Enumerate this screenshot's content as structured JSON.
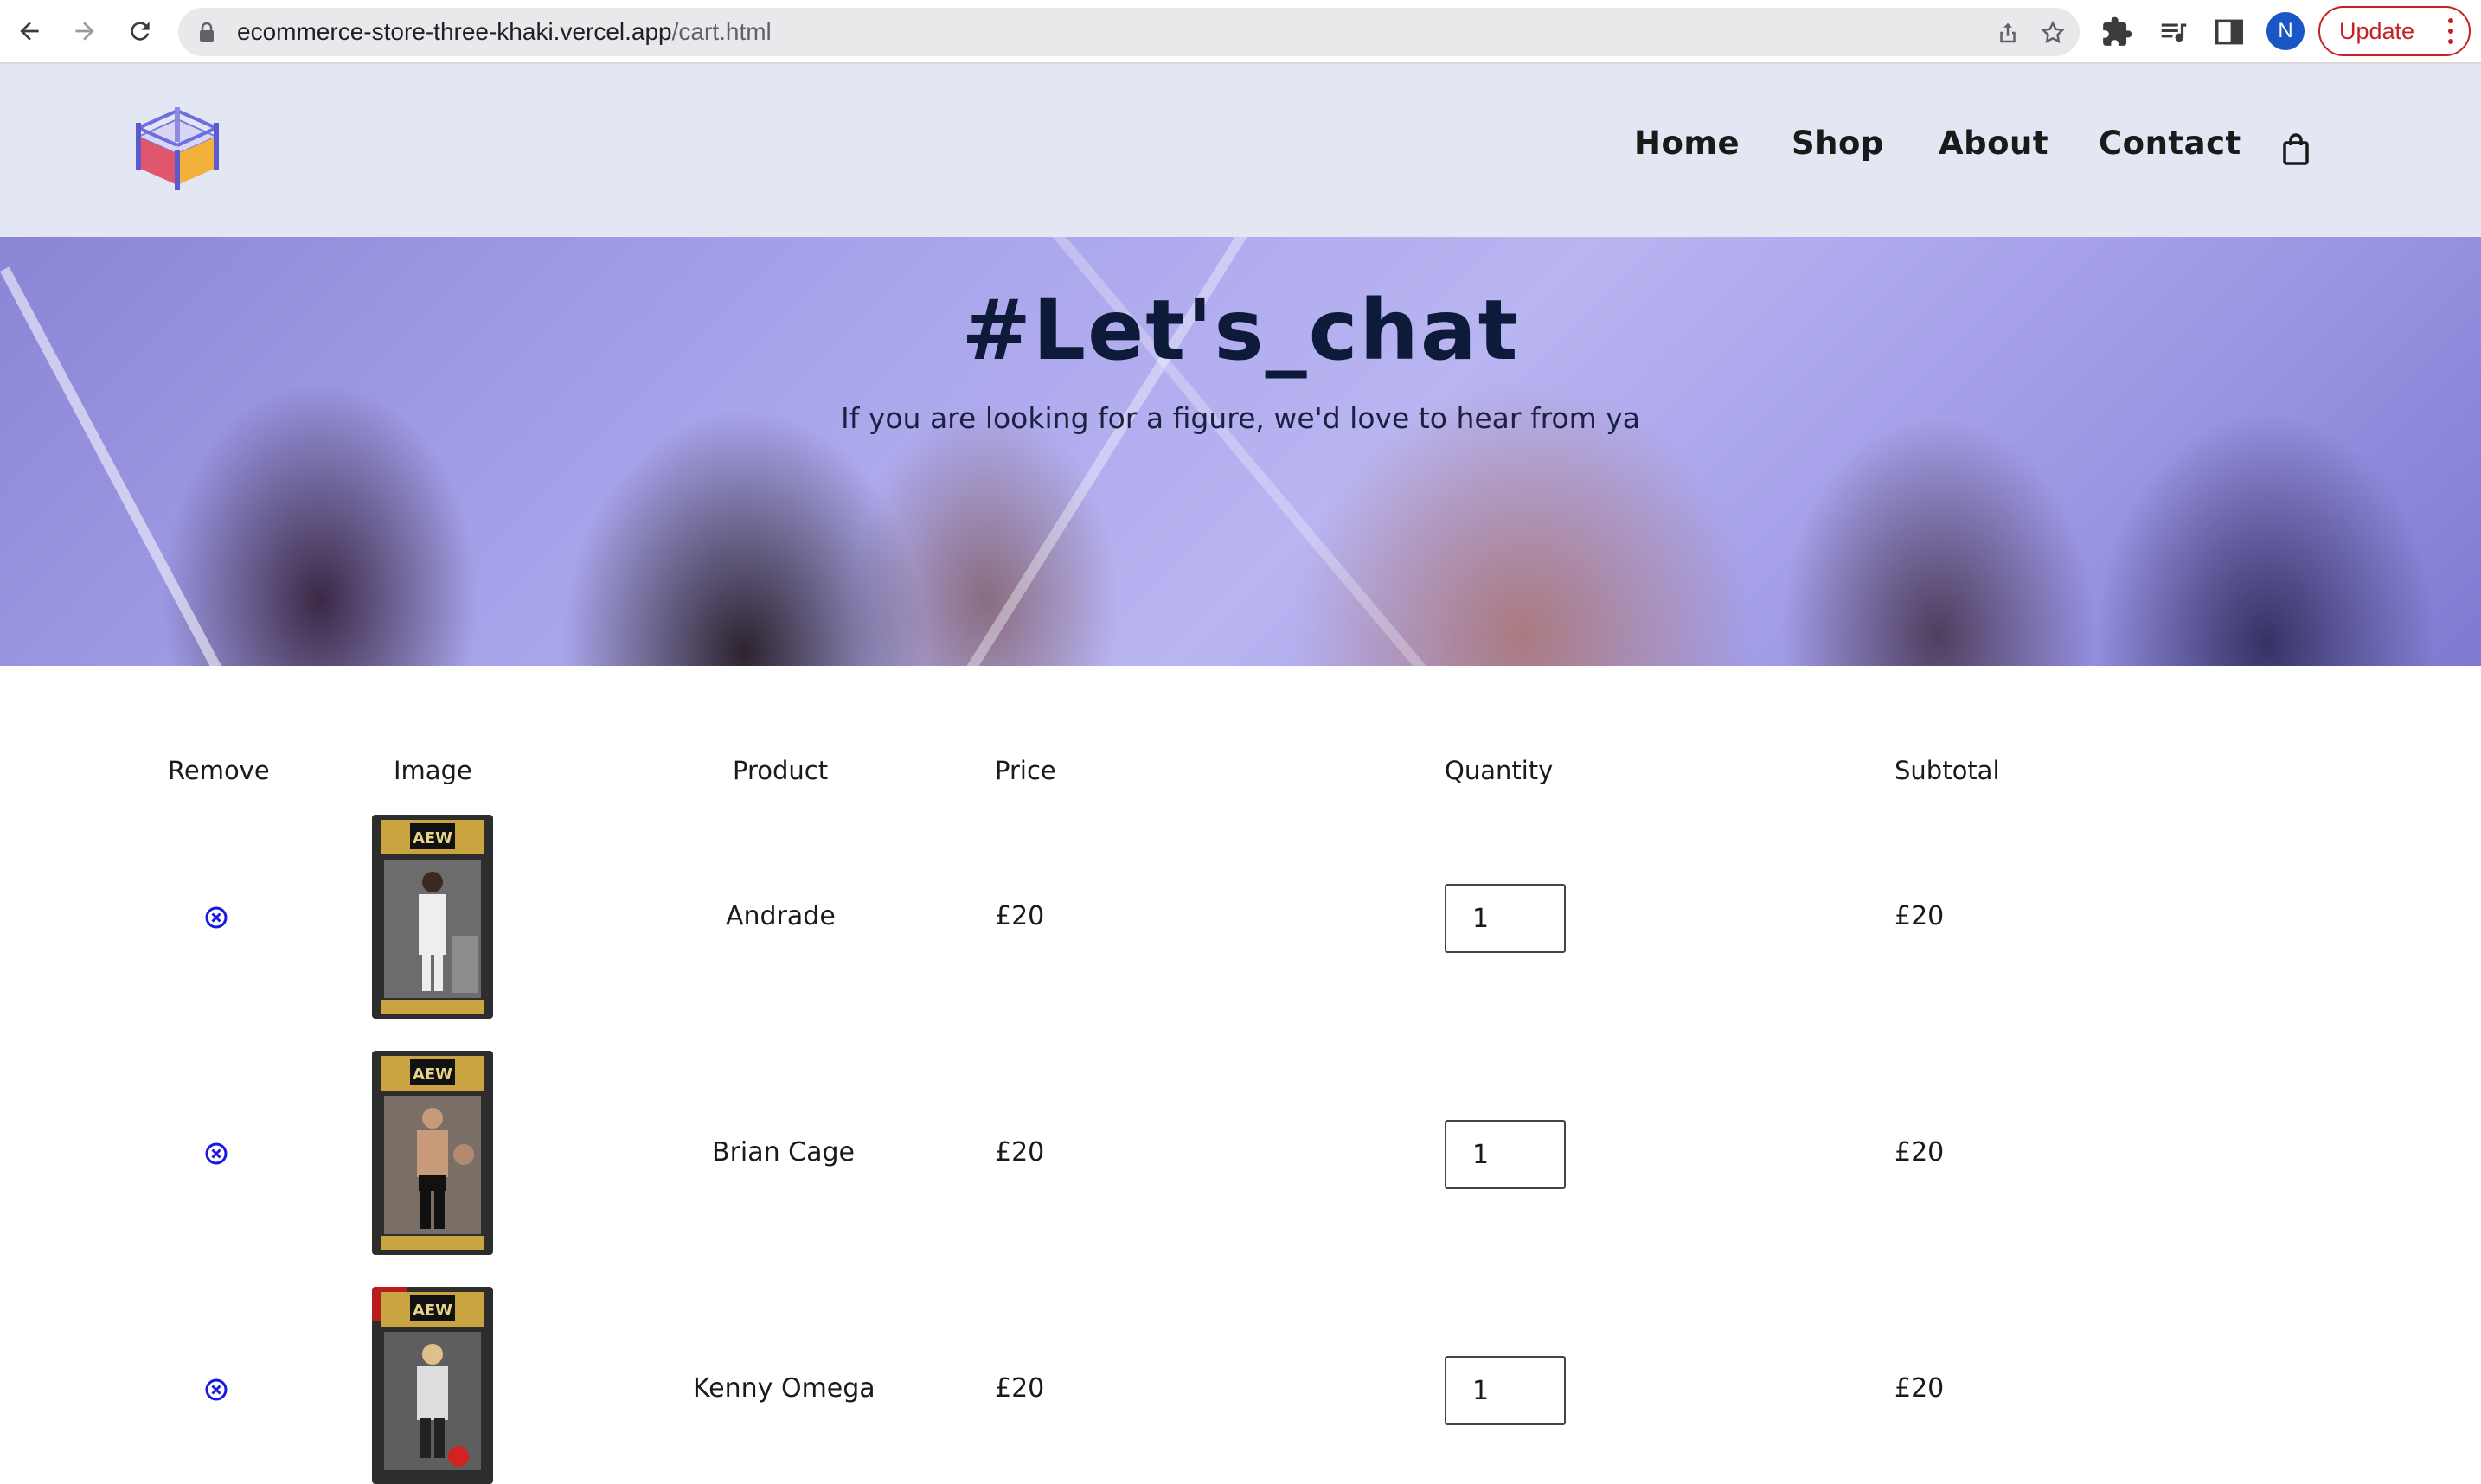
{
  "browser": {
    "url_host": "ecommerce-store-three-khaki.vercel.app",
    "url_path": "/cart.html",
    "avatar_initial": "N",
    "update_label": "Update"
  },
  "nav": {
    "items": [
      {
        "label": "Home"
      },
      {
        "label": "Shop"
      },
      {
        "label": "About"
      },
      {
        "label": "Contact"
      }
    ],
    "cart_icon": "shopping-bag-icon"
  },
  "hero": {
    "title": "#Let's_chat",
    "subtitle": "If you are looking for a figure, we'd love to hear from ya"
  },
  "cart": {
    "headers": {
      "remove": "Remove",
      "image": "Image",
      "product": "Product",
      "price": "Price",
      "quantity": "Quantity",
      "subtotal": "Subtotal"
    },
    "rows": [
      {
        "product": "Andrade",
        "price": "£20",
        "quantity": "1",
        "subtotal": "£20"
      },
      {
        "product": "Brian Cage",
        "price": "£20",
        "quantity": "1",
        "subtotal": "£20"
      },
      {
        "product": "Kenny Omega",
        "price": "£20",
        "quantity": "1",
        "subtotal": "£20"
      }
    ]
  },
  "colors": {
    "header_bg": "#e3e6f3",
    "remove_icon": "#1a1adf",
    "hero_title": "#0d1a3a"
  }
}
